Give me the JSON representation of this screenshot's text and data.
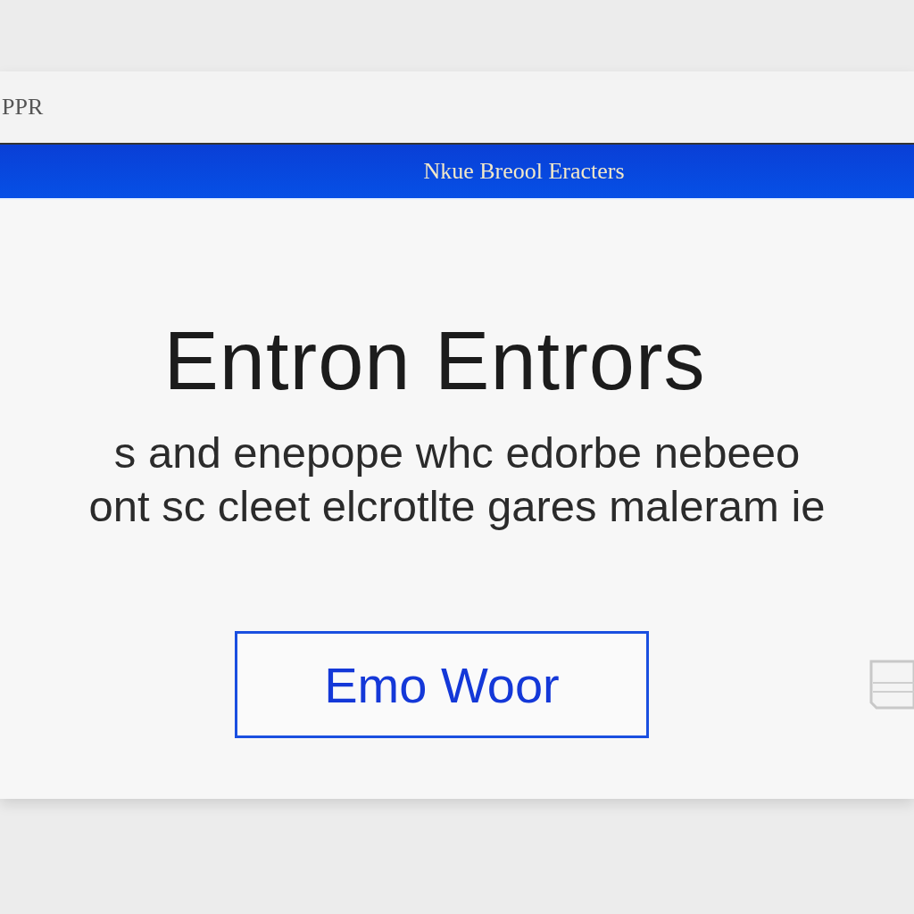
{
  "toolbar": {
    "label": "PPR"
  },
  "window": {
    "title": "Nkue Breool Eracters"
  },
  "heading": "Entron Entrors",
  "body_lines": [
    "s and enepope whc edorbe nebeeo",
    "ont sc cleet elcrotlte gares maleram ie"
  ],
  "buttons": [
    {
      "label": "Emo Woor"
    }
  ]
}
